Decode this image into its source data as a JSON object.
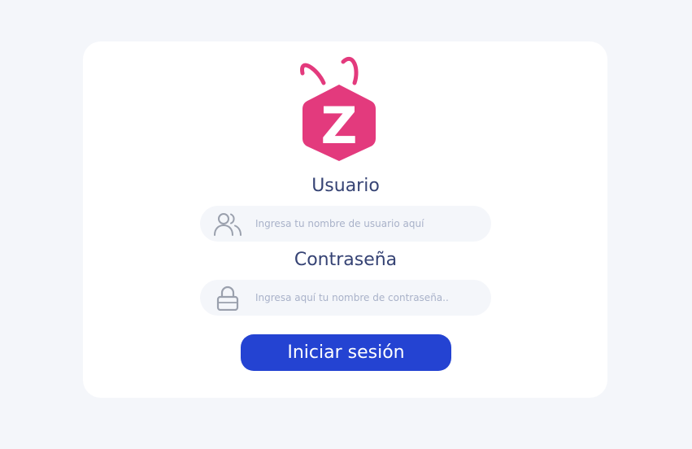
{
  "brand": {
    "logo_letter": "Z",
    "accent_color": "#e33a7d",
    "icon": "bug-hexagon-logo"
  },
  "login": {
    "username_label": "Usuario",
    "username_placeholder": "Ingresa tu nombre de usuario aquí",
    "username_icon": "users-icon",
    "password_label": "Contraseña",
    "password_placeholder": "Ingresa aquí tu nombre de contraseña..",
    "password_icon": "lock-icon",
    "submit_label": "Iniciar sesión",
    "button_color": "#2443d2"
  }
}
